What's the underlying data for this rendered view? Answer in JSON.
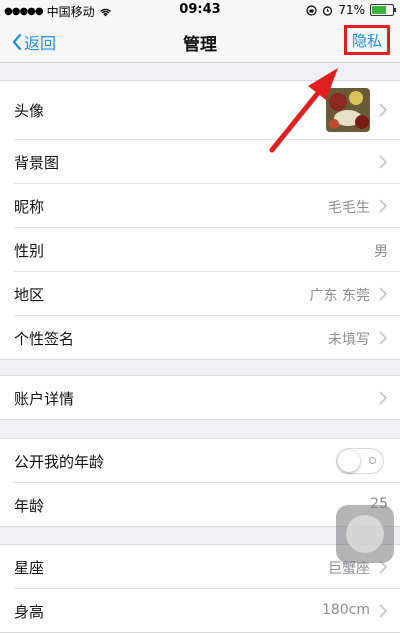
{
  "status_bar": {
    "carrier": "中国移动",
    "time": "09:43",
    "battery": "71%",
    "battery_level": 0.71
  },
  "nav": {
    "back_label": "返回",
    "title": "管理",
    "privacy_label": "隐私"
  },
  "profile": {
    "avatar_label": "头像",
    "background_label": "背景图",
    "nickname_label": "昵称",
    "nickname_value": "毛毛生",
    "gender_label": "性别",
    "gender_value": "男",
    "region_label": "地区",
    "region_value": "广东 东莞",
    "signature_label": "个性签名",
    "signature_value": "未填写"
  },
  "account": {
    "details_label": "账户详情"
  },
  "age": {
    "public_age_label": "公开我的年龄",
    "public_age_on": false,
    "age_label": "年龄",
    "age_value": "25"
  },
  "more": {
    "zodiac_label": "星座",
    "zodiac_value": "巨蟹座",
    "height_label": "身高",
    "height_value": "180cm"
  },
  "colors": {
    "accent": "#1e8de6",
    "highlight_box": "#e02020",
    "background": "#efeff4"
  }
}
